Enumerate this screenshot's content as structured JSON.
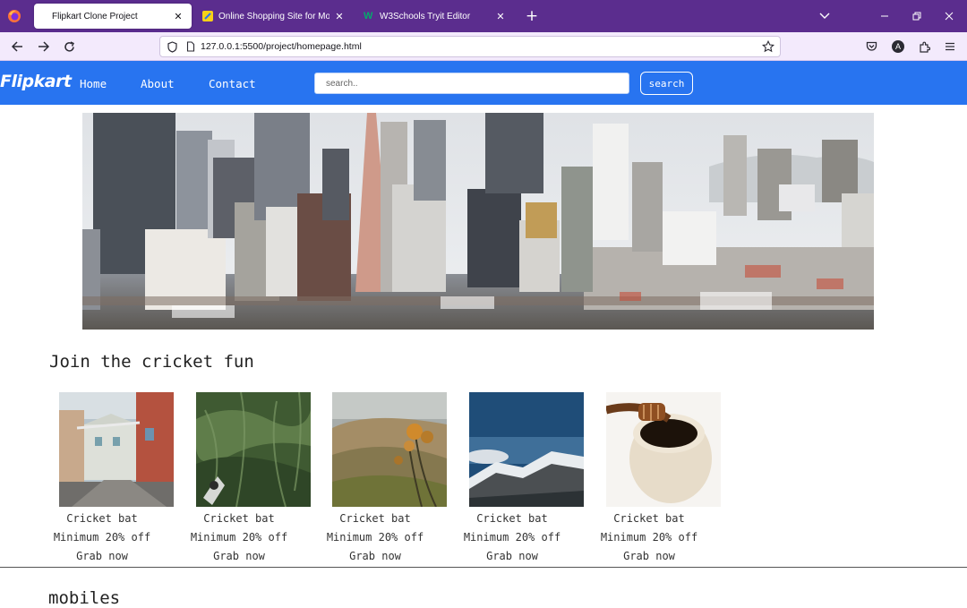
{
  "browser": {
    "tabs": [
      {
        "title": "Flipkart Clone Project",
        "active": true,
        "favicon": "page-icon"
      },
      {
        "title": "Online Shopping Site for Mobiles",
        "active": false,
        "favicon": "flipkart-favicon"
      },
      {
        "title": "W3Schools Tryit Editor",
        "active": false,
        "favicon": "w3schools-favicon"
      }
    ],
    "new_tab": "+",
    "url": "127.0.0.1:5500/project/homepage.html",
    "extension_avatar": "A",
    "colors": {
      "frame": "#5b2d8e",
      "toolbar": "#f3eafc"
    }
  },
  "site": {
    "logo": "Flipkart",
    "nav": [
      "Home",
      "About",
      "Contact"
    ],
    "search": {
      "placeholder": "search..",
      "button": "search"
    },
    "brand_color": "#2874f0",
    "section_title": "Join the cricket fun",
    "products": [
      {
        "title": "Cricket bat",
        "offer": "Minimum 20% off",
        "cta": "Grab now",
        "image": "street-photo"
      },
      {
        "title": "Cricket bat",
        "offer": "Minimum 20% off",
        "cta": "Grab now",
        "image": "grass-photo"
      },
      {
        "title": "Cricket bat",
        "offer": "Minimum 20% off",
        "cta": "Grab now",
        "image": "thistle-photo"
      },
      {
        "title": "Cricket bat",
        "offer": "Minimum 20% off",
        "cta": "Grab now",
        "image": "mountain-photo"
      },
      {
        "title": "Cricket bat",
        "offer": "Minimum 20% off",
        "cta": "Grab now",
        "image": "honey-photo"
      }
    ],
    "section2_title": "mobiles"
  }
}
